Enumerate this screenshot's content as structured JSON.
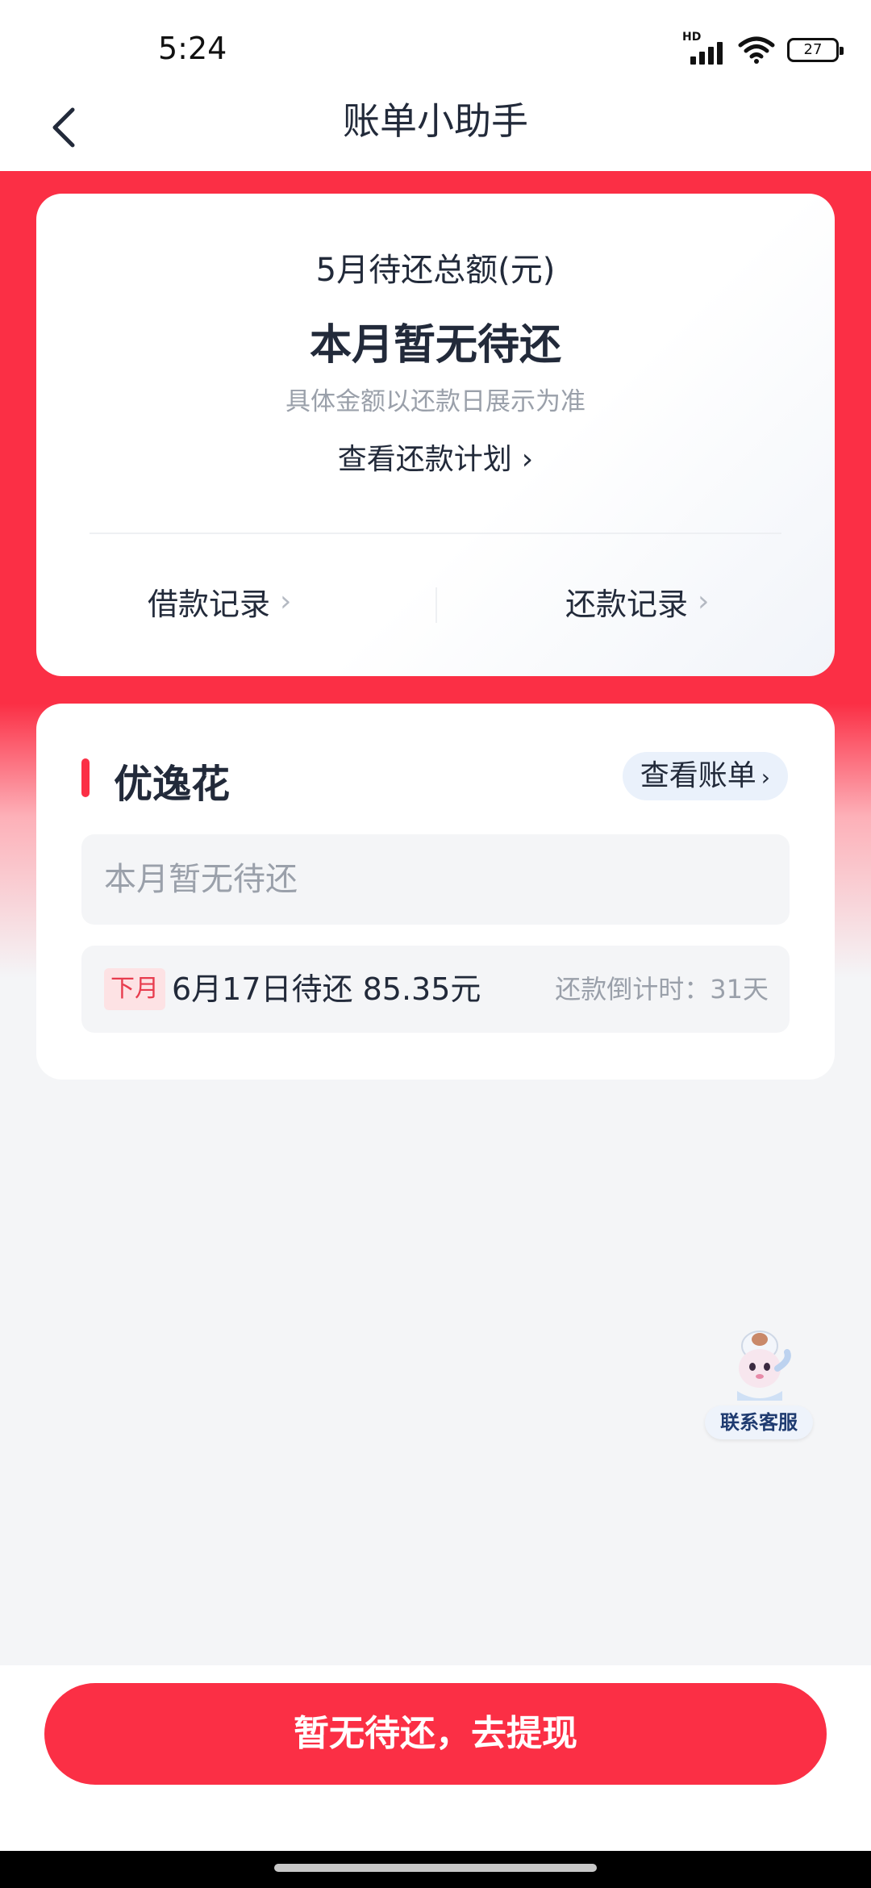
{
  "status_bar": {
    "time": "5:24",
    "network_label": "HD",
    "battery_level": "27",
    "icons": [
      "hd-signal-icon",
      "wifi-icon",
      "battery-icon"
    ]
  },
  "nav": {
    "title": "账单小助手",
    "back_icon": "chevron-left-icon"
  },
  "summary": {
    "month_label": "5月待还总额(元)",
    "amount_text": "本月暂无待还",
    "note": "具体金额以还款日展示为准",
    "plan_link": "查看还款计划",
    "borrow_records": "借款记录",
    "repay_records": "还款记录"
  },
  "product": {
    "name": "优逸花",
    "view_bill": "查看账单",
    "empty_text": "本月暂无待还",
    "next_tag": "下月",
    "next_text": "6月17日待还 85.35元",
    "countdown": "还款倒计时：31天"
  },
  "customer_service": {
    "label": "联系客服"
  },
  "cta": {
    "label": "暂无待还，去提现"
  },
  "colors": {
    "accent_red": "#fb2f45",
    "text_dark": "#222a3a",
    "text_muted": "#9aa0aa"
  }
}
